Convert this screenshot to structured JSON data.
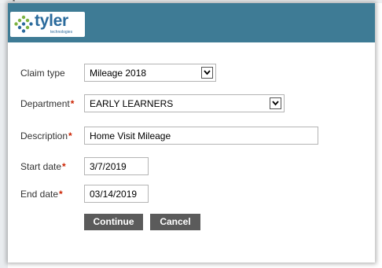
{
  "header": {
    "logo_text": "tyler",
    "logo_subtext": "technologies",
    "top_marker": "*"
  },
  "form": {
    "claim_type": {
      "label": "Claim type",
      "value": "Mileage 2018"
    },
    "department": {
      "label": "Department",
      "required_mark": "*",
      "value": "EARLY LEARNERS"
    },
    "description": {
      "label": "Description",
      "required_mark": "*",
      "value": "Home Visit Mileage"
    },
    "start_date": {
      "label": "Start date",
      "required_mark": "*",
      "value": "3/7/2019"
    },
    "end_date": {
      "label": "End date",
      "required_mark": "*",
      "value": "03/14/2019"
    }
  },
  "actions": {
    "continue_label": "Continue",
    "cancel_label": "Cancel"
  },
  "colors": {
    "header_bg": "#3e7b95",
    "button_bg": "#5b5b5b",
    "required": "#cc2200",
    "logo_blue": "#2a6a9c",
    "logo_green": "#7cb342"
  },
  "icons": [
    "tyler-logo-icon",
    "chevron-down-icon"
  ]
}
